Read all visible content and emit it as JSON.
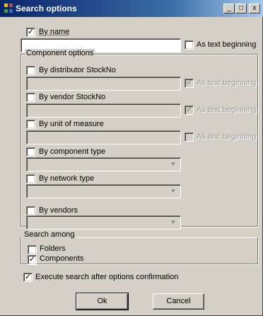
{
  "window": {
    "title": "Search options",
    "minimize_glyph": "_",
    "maximize_glyph": "□",
    "close_glyph": "x"
  },
  "by_name": {
    "label": "By name",
    "checked": true,
    "value": "",
    "as_text_beginning_label": "As text beginning",
    "as_text_beginning_checked": false
  },
  "component_options": {
    "legend": "Component options",
    "distributor": {
      "label": "By distributor StockNo",
      "checked": false,
      "as_text_label": "As text beginning",
      "as_text_checked": true
    },
    "vendor": {
      "label": "By vendor StockNo",
      "checked": false,
      "as_text_label": "As text beginning",
      "as_text_checked": true
    },
    "unit": {
      "label": "By unit of measure",
      "checked": false,
      "as_text_label": "As text beginning",
      "as_text_checked": false
    },
    "component_type": {
      "label": "By component type",
      "checked": false
    },
    "network_type": {
      "label": "By network type",
      "checked": false
    },
    "vendors": {
      "label": "By vendors",
      "checked": false
    }
  },
  "search_among": {
    "legend": "Search among",
    "folders": {
      "label": "Folders",
      "checked": false
    },
    "components": {
      "label": "Components",
      "checked": true
    }
  },
  "execute_after": {
    "label": "Execute search after options confirmation",
    "checked": true
  },
  "buttons": {
    "ok": "Ok",
    "cancel": "Cancel"
  },
  "check_mark": "✓",
  "dropdown_glyph": "▼"
}
